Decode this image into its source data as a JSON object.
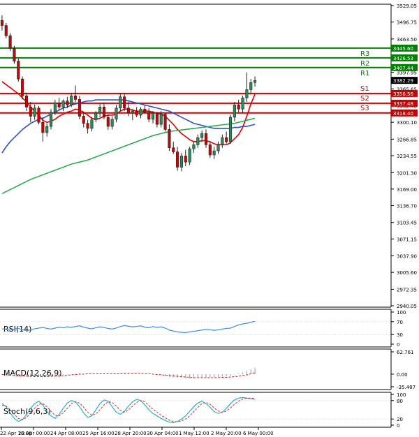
{
  "colors": {
    "up_candle": "#2e8b57",
    "down_candle": "#d40000",
    "resistance": "#008000",
    "support": "#cc0000",
    "ma_fast": "#e00000",
    "ma_mid": "#3050c8",
    "ma_slow": "#2eaa50",
    "rsi": "#3a8ee6",
    "macd": "#c81e1e",
    "stoch_k": "#2ab0c8",
    "stoch_d": "#d03030",
    "grid": "#dddddd",
    "panel_border": "#000000"
  },
  "chart_data": [
    {
      "type": "candlestick",
      "title": "",
      "ylim": [
        2940.05,
        3529.05
      ],
      "y_ticks": [
        "3529.05",
        "3496.75",
        "3463.50",
        "3430.70",
        "3397.95",
        "3365.65",
        "3332.40",
        "3300.10",
        "3266.85",
        "3234.55",
        "3201.30",
        "3169.00",
        "3136.70",
        "3103.45",
        "3071.15",
        "3037.90",
        "3005.60",
        "2972.35",
        "2940.05"
      ],
      "x_ticks": [
        "22 Apr 16:00",
        "23 Apr 00:00",
        "24 Apr 08:00",
        "25 Apr 16:00",
        "28 Apr 20:00",
        "30 Apr 04:00",
        "1 May 12:00",
        "2 May 20:00",
        "6 May 00:00"
      ],
      "levels": [
        {
          "label": "R3",
          "value": 3445.6,
          "box": "3445.60",
          "kind": "resistance"
        },
        {
          "label": "R2",
          "value": 3426.53,
          "box": "3426.53",
          "kind": "resistance"
        },
        {
          "label": "R1",
          "value": 3407.44,
          "box": "3407.44",
          "kind": "resistance"
        },
        {
          "label": "S1",
          "value": 3356.56,
          "box": "3356.56",
          "kind": "support"
        },
        {
          "label": "S2",
          "value": 3337.48,
          "box": "3337.48",
          "kind": "support"
        },
        {
          "label": "S3",
          "value": 3318.4,
          "box": "3318.40",
          "kind": "support"
        }
      ],
      "current_price": {
        "value": 3382.29,
        "box": "3382.29"
      },
      "candles": [
        {
          "o": 3500,
          "h": 3510,
          "l": 3480,
          "c": 3490
        },
        {
          "o": 3490,
          "h": 3495,
          "l": 3465,
          "c": 3470
        },
        {
          "o": 3470,
          "h": 3475,
          "l": 3440,
          "c": 3445
        },
        {
          "o": 3445,
          "h": 3450,
          "l": 3415,
          "c": 3420
        },
        {
          "o": 3420,
          "h": 3425,
          "l": 3380,
          "c": 3385
        },
        {
          "o": 3385,
          "h": 3390,
          "l": 3345,
          "c": 3352
        },
        {
          "o": 3352,
          "h": 3358,
          "l": 3322,
          "c": 3330
        },
        {
          "o": 3330,
          "h": 3340,
          "l": 3300,
          "c": 3312
        },
        {
          "o": 3312,
          "h": 3335,
          "l": 3305,
          "c": 3328
        },
        {
          "o": 3328,
          "h": 3332,
          "l": 3296,
          "c": 3300
        },
        {
          "o": 3300,
          "h": 3310,
          "l": 3262,
          "c": 3280
        },
        {
          "o": 3280,
          "h": 3298,
          "l": 3272,
          "c": 3292
        },
        {
          "o": 3292,
          "h": 3326,
          "l": 3286,
          "c": 3320
        },
        {
          "o": 3320,
          "h": 3344,
          "l": 3314,
          "c": 3338
        },
        {
          "o": 3338,
          "h": 3348,
          "l": 3325,
          "c": 3330
        },
        {
          "o": 3330,
          "h": 3345,
          "l": 3322,
          "c": 3342
        },
        {
          "o": 3342,
          "h": 3350,
          "l": 3328,
          "c": 3334
        },
        {
          "o": 3334,
          "h": 3358,
          "l": 3330,
          "c": 3352
        },
        {
          "o": 3352,
          "h": 3372,
          "l": 3340,
          "c": 3345
        },
        {
          "o": 3345,
          "h": 3352,
          "l": 3306,
          "c": 3312
        },
        {
          "o": 3312,
          "h": 3320,
          "l": 3290,
          "c": 3298
        },
        {
          "o": 3298,
          "h": 3305,
          "l": 3278,
          "c": 3288
        },
        {
          "o": 3288,
          "h": 3310,
          "l": 3282,
          "c": 3305
        },
        {
          "o": 3305,
          "h": 3322,
          "l": 3300,
          "c": 3318
        },
        {
          "o": 3318,
          "h": 3336,
          "l": 3310,
          "c": 3330
        },
        {
          "o": 3330,
          "h": 3338,
          "l": 3306,
          "c": 3310
        },
        {
          "o": 3310,
          "h": 3316,
          "l": 3285,
          "c": 3292
        },
        {
          "o": 3292,
          "h": 3312,
          "l": 3286,
          "c": 3306
        },
        {
          "o": 3306,
          "h": 3334,
          "l": 3300,
          "c": 3328
        },
        {
          "o": 3328,
          "h": 3356,
          "l": 3322,
          "c": 3350
        },
        {
          "o": 3350,
          "h": 3356,
          "l": 3322,
          "c": 3328
        },
        {
          "o": 3328,
          "h": 3340,
          "l": 3312,
          "c": 3318
        },
        {
          "o": 3318,
          "h": 3326,
          "l": 3304,
          "c": 3322
        },
        {
          "o": 3322,
          "h": 3330,
          "l": 3310,
          "c": 3314
        },
        {
          "o": 3314,
          "h": 3330,
          "l": 3308,
          "c": 3326
        },
        {
          "o": 3326,
          "h": 3333,
          "l": 3318,
          "c": 3320
        },
        {
          "o": 3320,
          "h": 3328,
          "l": 3300,
          "c": 3306
        },
        {
          "o": 3306,
          "h": 3322,
          "l": 3298,
          "c": 3318
        },
        {
          "o": 3318,
          "h": 3320,
          "l": 3290,
          "c": 3296
        },
        {
          "o": 3296,
          "h": 3322,
          "l": 3290,
          "c": 3316
        },
        {
          "o": 3316,
          "h": 3318,
          "l": 3282,
          "c": 3286
        },
        {
          "o": 3286,
          "h": 3296,
          "l": 3244,
          "c": 3250
        },
        {
          "o": 3250,
          "h": 3262,
          "l": 3238,
          "c": 3242
        },
        {
          "o": 3242,
          "h": 3252,
          "l": 3205,
          "c": 3212
        },
        {
          "o": 3212,
          "h": 3240,
          "l": 3204,
          "c": 3234
        },
        {
          "o": 3234,
          "h": 3246,
          "l": 3214,
          "c": 3222
        },
        {
          "o": 3222,
          "h": 3252,
          "l": 3216,
          "c": 3248
        },
        {
          "o": 3248,
          "h": 3262,
          "l": 3240,
          "c": 3256
        },
        {
          "o": 3256,
          "h": 3276,
          "l": 3250,
          "c": 3270
        },
        {
          "o": 3270,
          "h": 3284,
          "l": 3262,
          "c": 3278
        },
        {
          "o": 3278,
          "h": 3286,
          "l": 3250,
          "c": 3256
        },
        {
          "o": 3256,
          "h": 3262,
          "l": 3230,
          "c": 3236
        },
        {
          "o": 3236,
          "h": 3252,
          "l": 3228,
          "c": 3244
        },
        {
          "o": 3244,
          "h": 3262,
          "l": 3238,
          "c": 3256
        },
        {
          "o": 3256,
          "h": 3276,
          "l": 3250,
          "c": 3270
        },
        {
          "o": 3270,
          "h": 3282,
          "l": 3258,
          "c": 3262
        },
        {
          "o": 3262,
          "h": 3315,
          "l": 3258,
          "c": 3310
        },
        {
          "o": 3310,
          "h": 3340,
          "l": 3302,
          "c": 3334
        },
        {
          "o": 3334,
          "h": 3344,
          "l": 3320,
          "c": 3326
        },
        {
          "o": 3326,
          "h": 3352,
          "l": 3318,
          "c": 3348
        },
        {
          "o": 3348,
          "h": 3398,
          "l": 3340,
          "c": 3364
        },
        {
          "o": 3364,
          "h": 3385,
          "l": 3356,
          "c": 3378
        },
        {
          "o": 3378,
          "h": 3390,
          "l": 3370,
          "c": 3382
        }
      ],
      "series": [
        {
          "values": [
            3380,
            3374,
            3368,
            3362,
            3356,
            3348,
            3340,
            3330,
            3322,
            3314,
            3304,
            3300,
            3302,
            3306,
            3312,
            3316,
            3320,
            3322,
            3326,
            3324,
            3320,
            3314,
            3308,
            3306,
            3308,
            3312,
            3314,
            3314,
            3316,
            3322,
            3326,
            3326,
            3324,
            3322,
            3322,
            3322,
            3322,
            3320,
            3318,
            3316,
            3312,
            3304,
            3296,
            3286,
            3278,
            3272,
            3266,
            3262,
            3262,
            3264,
            3264,
            3262,
            3258,
            3256,
            3256,
            3256,
            3260,
            3268,
            3276,
            3290,
            3312,
            3336,
            3355
          ]
        },
        {
          "values": [
            3240,
            3252,
            3262,
            3270,
            3278,
            3286,
            3292,
            3298,
            3302,
            3306,
            3308,
            3312,
            3316,
            3320,
            3324,
            3328,
            3330,
            3334,
            3336,
            3338,
            3340,
            3342,
            3342,
            3344,
            3344,
            3344,
            3344,
            3344,
            3344,
            3344,
            3344,
            3342,
            3340,
            3338,
            3336,
            3334,
            3332,
            3330,
            3328,
            3326,
            3324,
            3322,
            3318,
            3314,
            3310,
            3306,
            3302,
            3298,
            3296,
            3294,
            3292,
            3290,
            3288,
            3288,
            3288,
            3288,
            3288,
            3290,
            3290,
            3292,
            3292,
            3294,
            3296
          ]
        },
        {
          "values": [
            3160,
            3164,
            3168,
            3172,
            3176,
            3180,
            3184,
            3188,
            3191,
            3194,
            3197,
            3200,
            3203,
            3206,
            3209,
            3212,
            3215,
            3218,
            3220,
            3222,
            3224,
            3226,
            3229,
            3232,
            3235,
            3238,
            3241,
            3244,
            3247,
            3250,
            3253,
            3256,
            3259,
            3262,
            3265,
            3268,
            3271,
            3274,
            3276,
            3278,
            3280,
            3282,
            3283,
            3284,
            3285,
            3286,
            3287,
            3288,
            3289,
            3290,
            3291,
            3292,
            3293,
            3294,
            3295,
            3296,
            3297,
            3298,
            3300,
            3302,
            3304,
            3306,
            3308
          ]
        }
      ]
    },
    {
      "type": "line",
      "title": "RSI(14)",
      "ylim": [
        0,
        100
      ],
      "y_ticks": [
        "100",
        "70",
        "30",
        "0"
      ],
      "series": [
        {
          "values": [
            48,
            46,
            44,
            47,
            49,
            45,
            42,
            44,
            48,
            50,
            52,
            49,
            47,
            50,
            53,
            51,
            54,
            52,
            55,
            57,
            53,
            50,
            48,
            51,
            54,
            52,
            49,
            47,
            50,
            55,
            58,
            56,
            54,
            55,
            57,
            53,
            51,
            55,
            52,
            54,
            50,
            44,
            41,
            38,
            37,
            36,
            38,
            40,
            42,
            44,
            46,
            45,
            43,
            45,
            47,
            49,
            50,
            55,
            60,
            63,
            65,
            68,
            71
          ]
        }
      ]
    },
    {
      "type": "bar",
      "title": "MACD(12,26,9)",
      "ylim": [
        -35.487,
        62.761
      ],
      "y_ticks": [
        "62.761",
        "0.00",
        "-35.487"
      ],
      "series": [
        {
          "values": [
            -2,
            -3,
            -4,
            -5,
            -6,
            -7,
            -7,
            -8,
            -8,
            -7,
            -7,
            -6,
            -5,
            -4,
            -3,
            -2,
            -1,
            0,
            1,
            2,
            1,
            1,
            0,
            0,
            1,
            2,
            2,
            1,
            1,
            2,
            3,
            3,
            2,
            1,
            1,
            0,
            0,
            -1,
            -2,
            -3,
            -5,
            -7,
            -9,
            -10,
            -11,
            -11,
            -12,
            -12,
            -11,
            -10,
            -10,
            -9,
            -9,
            -8,
            -7,
            -6,
            -4,
            -1,
            2,
            5,
            9,
            14,
            18
          ]
        },
        {
          "values": [
            -1,
            -2,
            -3,
            -4,
            -5,
            -5,
            -6,
            -6,
            -7,
            -7,
            -7,
            -7,
            -6,
            -6,
            -5,
            -4,
            -3,
            -2,
            -1,
            0,
            0,
            1,
            1,
            1,
            1,
            1,
            1,
            1,
            1,
            1,
            2,
            2,
            2,
            2,
            2,
            1,
            1,
            0,
            -1,
            -2,
            -3,
            -4,
            -5,
            -6,
            -7,
            -8,
            -9,
            -10,
            -10,
            -10,
            -10,
            -10,
            -10,
            -10,
            -9,
            -9,
            -8,
            -7,
            -6,
            -4,
            -2,
            1,
            4
          ]
        }
      ]
    },
    {
      "type": "line",
      "title": "Stoch(9,6,3)",
      "ylim": [
        0,
        100
      ],
      "y_ticks": [
        "100",
        "80",
        "20",
        "0"
      ],
      "series": [
        {
          "values": [
            70,
            60,
            40,
            22,
            12,
            18,
            35,
            55,
            70,
            78,
            65,
            45,
            30,
            22,
            35,
            55,
            72,
            80,
            75,
            60,
            40,
            25,
            30,
            50,
            70,
            82,
            78,
            60,
            42,
            35,
            45,
            62,
            76,
            84,
            80,
            66,
            50,
            38,
            30,
            22,
            15,
            10,
            8,
            12,
            20,
            30,
            45,
            60,
            72,
            78,
            70,
            58,
            44,
            38,
            42,
            55,
            70,
            82,
            88,
            90,
            88,
            86,
            84
          ]
        },
        {
          "values": [
            65,
            62,
            50,
            35,
            22,
            18,
            25,
            40,
            55,
            68,
            70,
            60,
            45,
            32,
            30,
            40,
            55,
            70,
            76,
            72,
            58,
            42,
            32,
            36,
            50,
            66,
            76,
            74,
            62,
            48,
            42,
            50,
            62,
            74,
            80,
            76,
            64,
            52,
            42,
            32,
            24,
            16,
            12,
            11,
            14,
            20,
            30,
            44,
            58,
            70,
            74,
            68,
            56,
            46,
            42,
            46,
            56,
            68,
            78,
            85,
            88,
            88,
            87
          ]
        }
      ]
    }
  ]
}
